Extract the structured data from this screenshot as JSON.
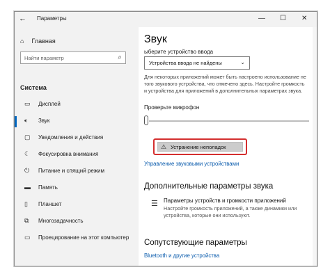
{
  "window": {
    "back_glyph": "←",
    "title": "Параметры",
    "minimize": "—",
    "maximize": "☐",
    "close": "✕"
  },
  "sidebar": {
    "home_label": "Главная",
    "search_placeholder": "Найти параметр",
    "section_title": "Система",
    "items": [
      {
        "label": "Дисплей",
        "icon": "display-icon"
      },
      {
        "label": "Звук",
        "icon": "speaker-icon",
        "active": true
      },
      {
        "label": "Уведомления и действия",
        "icon": "notifications-icon"
      },
      {
        "label": "Фокусировка внимания",
        "icon": "moon-icon"
      },
      {
        "label": "Питание и спящий режим",
        "icon": "power-icon"
      },
      {
        "label": "Память",
        "icon": "storage-icon"
      },
      {
        "label": "Планшет",
        "icon": "tablet-icon"
      },
      {
        "label": "Многозадачность",
        "icon": "multitasking-icon"
      },
      {
        "label": "Проецирование на этот компьютер",
        "icon": "projecting-icon"
      }
    ]
  },
  "main": {
    "title": "Звук",
    "choose_input_label": "ыберите устройство ввода",
    "input_device_value": "Устройства ввода не найдены",
    "info_text": "Для некоторых приложений может быть настроено использование не того звукового устройства, что отмечено здесь. Настройте громкость и устройства для приложений в дополнительных параметрах звука.",
    "check_mic_label": "Проверьте микрофон",
    "troubleshoot_label": "Устранение неполадок",
    "manage_devices_link": "Управление звуковыми устройствами",
    "advanced_title": "Дополнительные параметры звука",
    "advanced_item_title": "Параметры устройств и громкости приложений",
    "advanced_item_desc": "Настройте громкость приложений, а также динамики или устройства, которые они используют.",
    "related_title": "Сопутствующие параметры",
    "bluetooth_link": "Bluetooth и другие устройства"
  }
}
